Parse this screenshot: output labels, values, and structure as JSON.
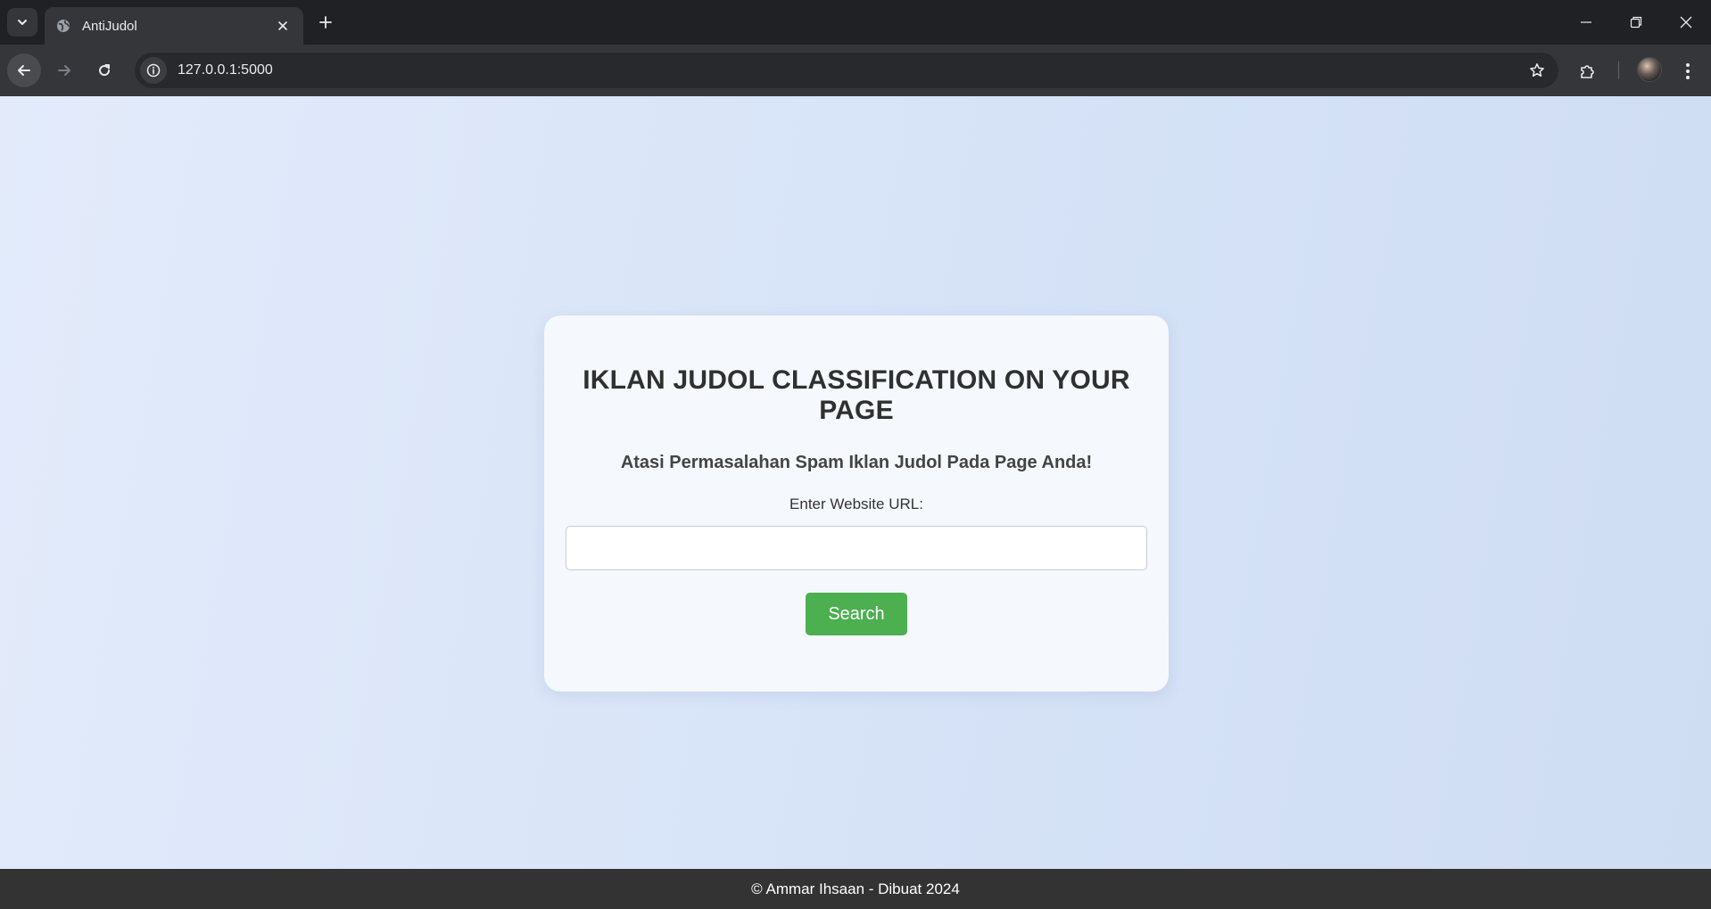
{
  "browser": {
    "tab_title": "AntiJudol",
    "url": "127.0.0.1:5000"
  },
  "page": {
    "heading": "IKLAN JUDOL CLASSIFICATION ON YOUR PAGE",
    "subheading": "Atasi Permasalahan Spam Iklan Judol Pada Page Anda!",
    "url_label": "Enter Website URL:",
    "url_input_value": "",
    "url_input_placeholder": "",
    "search_button_label": "Search",
    "footer_text": "© Ammar Ihsaan - Dibuat 2024"
  },
  "colors": {
    "button_green": "#4caf50",
    "footer_bg": "#333333",
    "page_gradient_start": "#e3ebfb",
    "page_gradient_end": "#cfddf3"
  }
}
